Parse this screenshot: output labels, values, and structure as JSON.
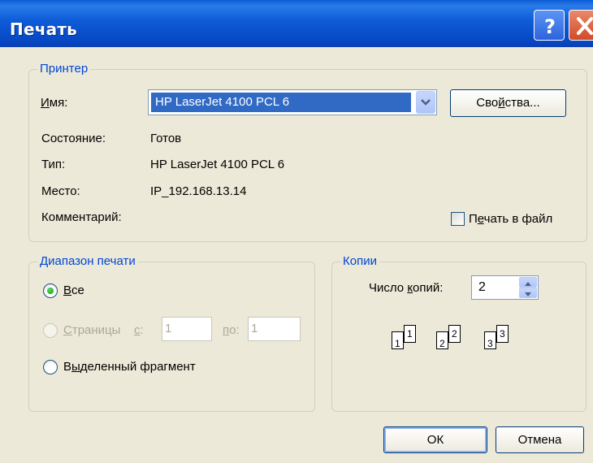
{
  "window": {
    "title": "Печать"
  },
  "printer": {
    "legend": "Принтер",
    "name_label_pre": "",
    "name_label_u": "И",
    "name_label_post": "мя:",
    "name_value": "HP LaserJet 4100 PCL 6",
    "properties_pre": "Сво",
    "properties_u": "й",
    "properties_post": "ства...",
    "status_label": "Состояние:",
    "status_value": "Готов",
    "type_label": "Тип:",
    "type_value": "HP LaserJet 4100 PCL 6",
    "location_label": "Место:",
    "location_value": "IP_192.168.13.14",
    "comment_label": "Комментарий:",
    "print_to_file_pre": "П",
    "print_to_file_u": "е",
    "print_to_file_post": "чать в файл"
  },
  "range": {
    "legend": "Диапазон печати",
    "all_u": "В",
    "all_post": "се",
    "pages_pre": "",
    "pages_u": "С",
    "pages_post": "траницы",
    "from_u": "с",
    "from_post": ":",
    "from_value": "1",
    "to_u": "п",
    "to_post": "о:",
    "to_value": "1",
    "selection_pre": "В",
    "selection_u": "ы",
    "selection_post": "деленный фрагмент"
  },
  "copies": {
    "legend": "Копии",
    "count_pre": "Число ",
    "count_u": "к",
    "count_post": "опий:",
    "count_value": "2",
    "collate_pages": [
      "1",
      "1",
      "2",
      "2",
      "3",
      "3"
    ]
  },
  "buttons": {
    "ok": "ОК",
    "cancel": "Отмена"
  }
}
